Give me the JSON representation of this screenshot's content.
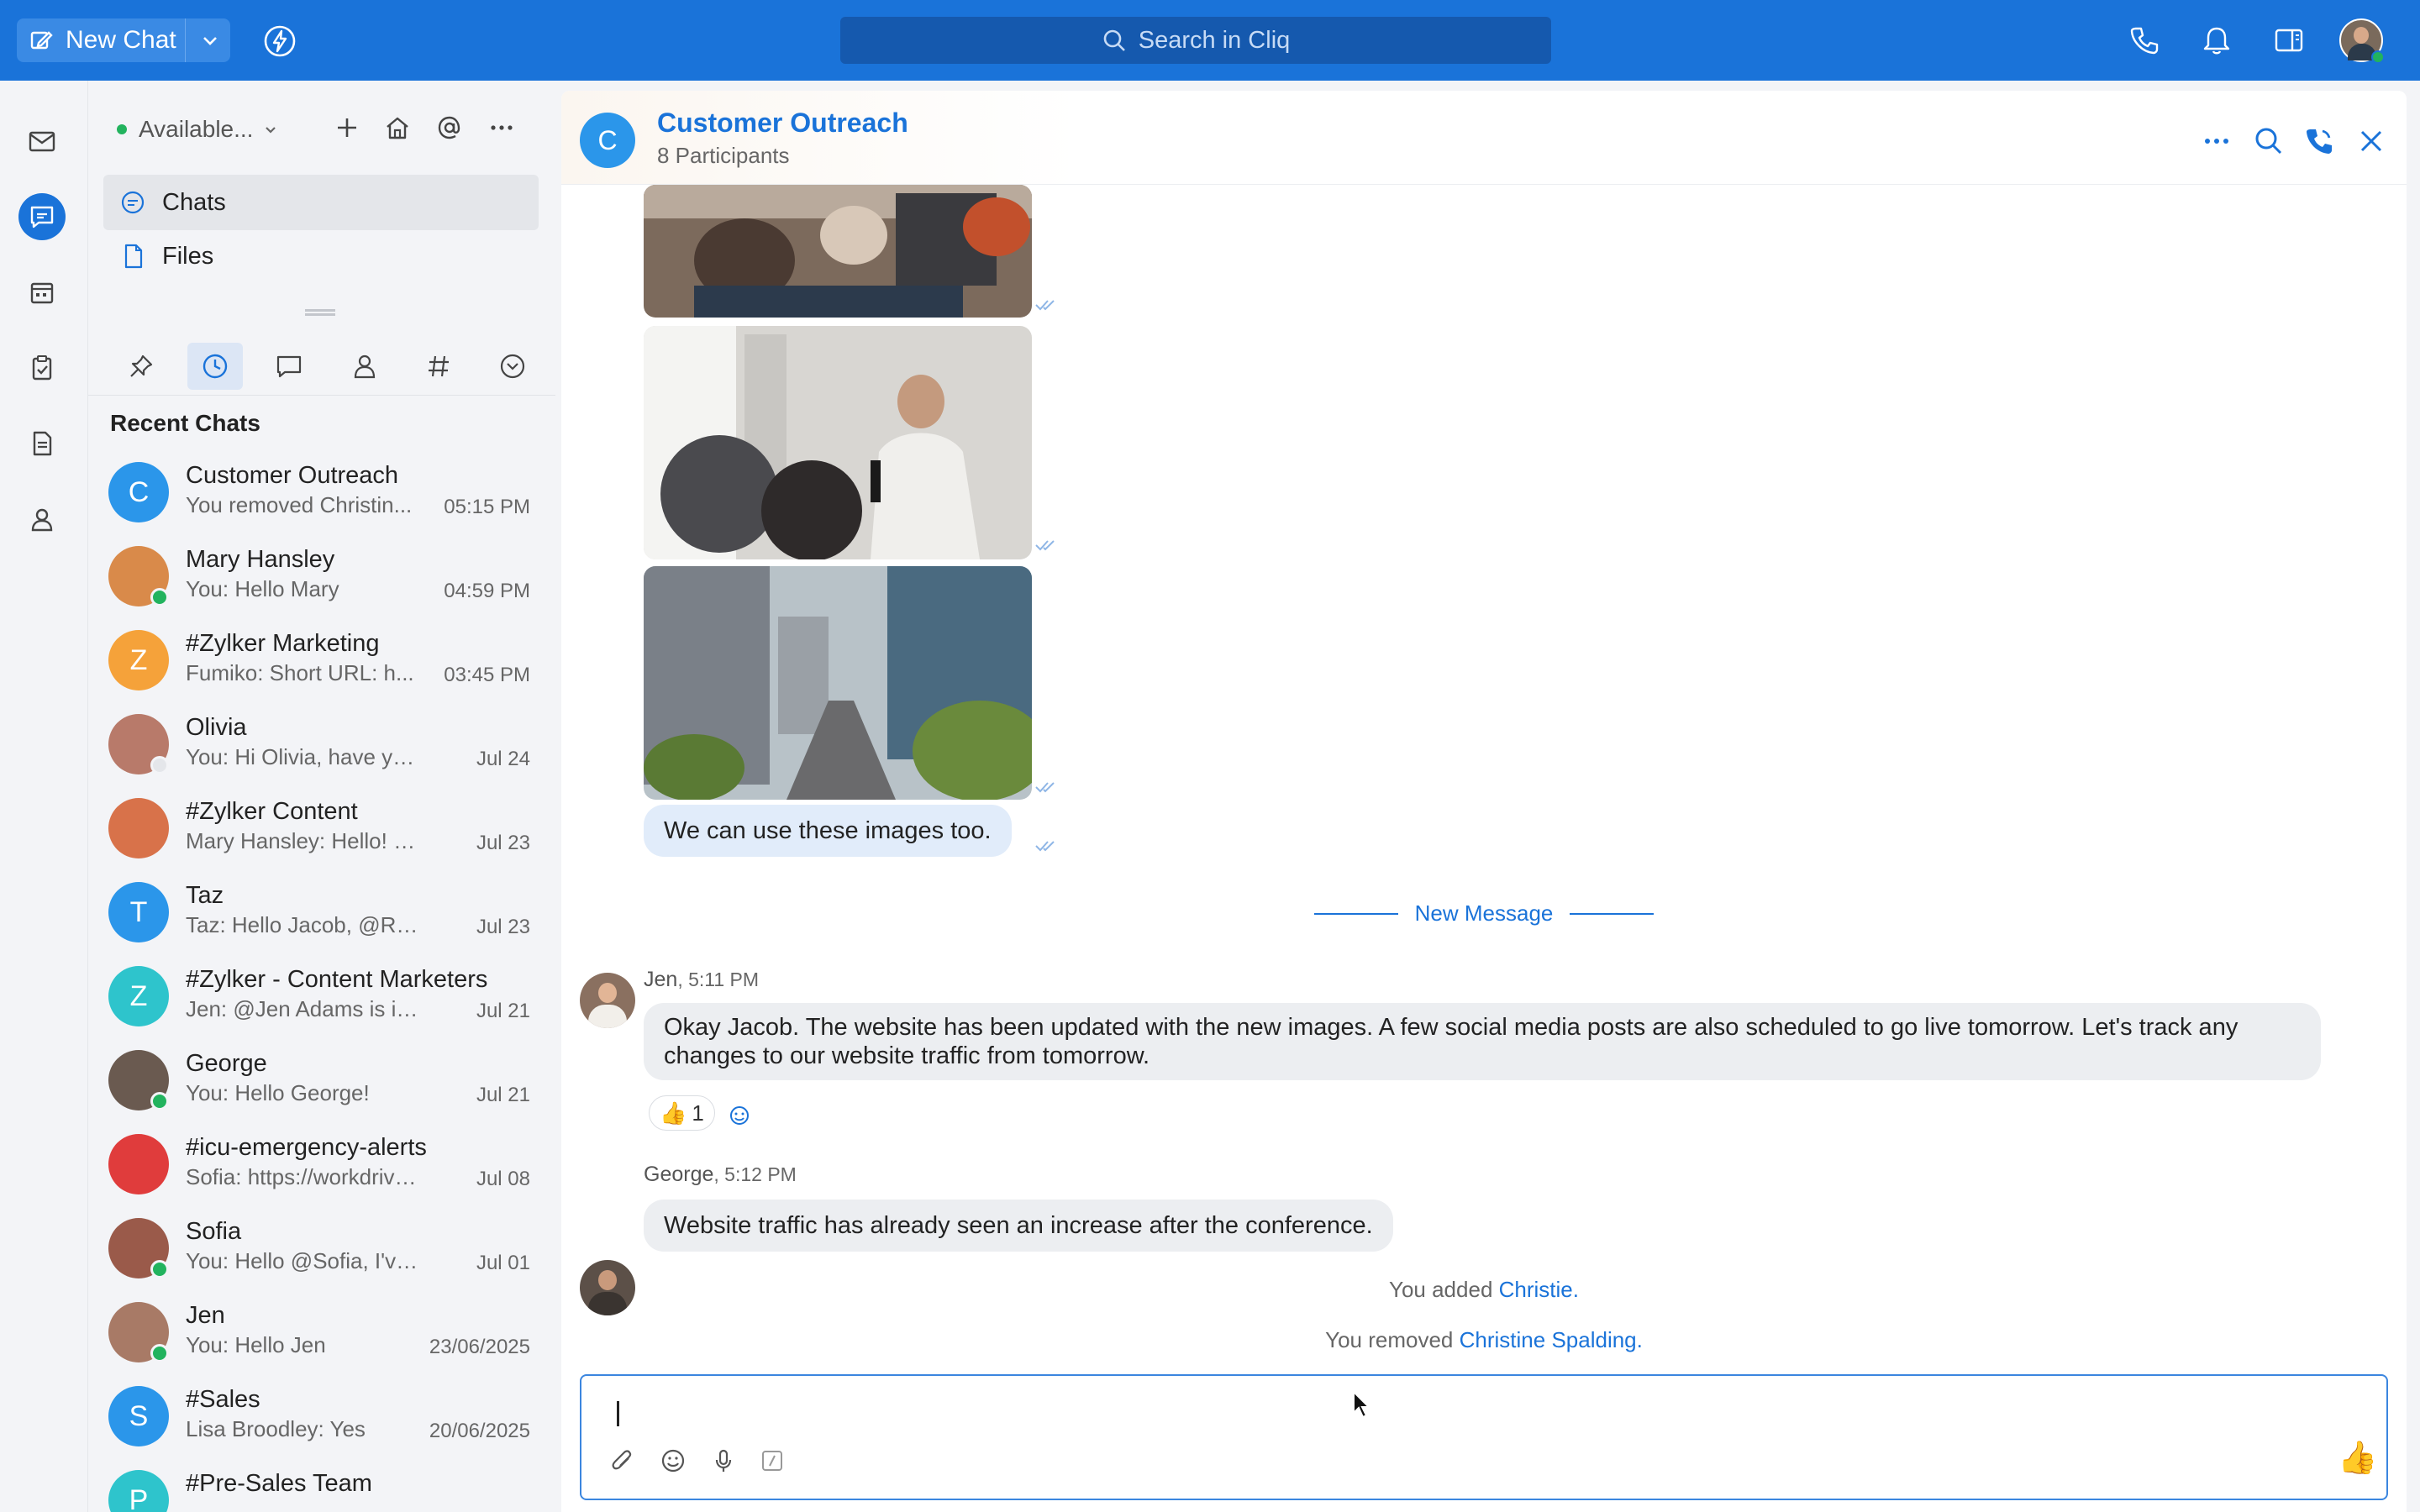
{
  "topbar": {
    "new_chat_label": "New Chat",
    "search_placeholder": "Search in Cliq"
  },
  "sidebar": {
    "status": "Available...",
    "nav": [
      {
        "label": "Chats"
      },
      {
        "label": "Files"
      }
    ],
    "recent_title": "Recent Chats",
    "chats": [
      {
        "name": "Customer Outreach",
        "preview": "You removed Christin...",
        "time": "05:15 PM",
        "initial": "C",
        "color": "#2b96ea"
      },
      {
        "name": "Mary  Hansley",
        "preview": "You: Hello Mary",
        "time": "04:59 PM",
        "initial": "",
        "color": "#d98a4a"
      },
      {
        "name": "#Zylker Marketing",
        "preview": "Fumiko: Short URL: h...",
        "time": "03:45 PM",
        "initial": "Z",
        "color": "#f5a23a"
      },
      {
        "name": "Olivia",
        "preview": "You: Hi Olivia, have you h...",
        "time": "Jul 24",
        "initial": "",
        "color": "#b87a6a"
      },
      {
        "name": "#Zylker Content",
        "preview": "Mary Hansley: Hello! @M...",
        "time": "Jul 23",
        "initial": "",
        "color": "#d8724a"
      },
      {
        "name": "Taz",
        "preview": "Taz: Hello Jacob,  @Regi...",
        "time": "Jul 23",
        "initial": "T",
        "color": "#2b96ea"
      },
      {
        "name": "#Zylker - Content Marketers",
        "preview": "Jen: @Jen Adams  is inviti...",
        "time": "Jul 21",
        "initial": "Z",
        "color": "#2ec4cc"
      },
      {
        "name": "George",
        "preview": "You: Hello George!",
        "time": "Jul 21",
        "initial": "",
        "color": "#6a5a50"
      },
      {
        "name": "#icu-emergency-alerts",
        "preview": "Sofia: https://workdrive....",
        "time": "Jul 08",
        "initial": "",
        "color": "#e03c3c"
      },
      {
        "name": "Sofia",
        "preview": "You: Hello @Sofia, I've sh...",
        "time": "Jul 01",
        "initial": "",
        "color": "#9a5a4a"
      },
      {
        "name": "Jen",
        "preview": "You: Hello Jen",
        "time": "23/06/2025",
        "initial": "",
        "color": "#a87a66"
      },
      {
        "name": "#Sales",
        "preview": "Lisa Broodley: Yes",
        "time": "20/06/2025",
        "initial": "S",
        "color": "#2b96ea"
      },
      {
        "name": "#Pre-Sales Team",
        "preview": "",
        "time": "",
        "initial": "P",
        "color": "#2ec4cc"
      }
    ]
  },
  "chat": {
    "title": "Customer Outreach",
    "initial": "C",
    "participants": "8 Participants",
    "my_message": "We can use these images too.",
    "new_message_label": "New Message",
    "messages": [
      {
        "sender": "Jen",
        "time": ", 5:11 PM",
        "text": "Okay Jacob. The website has been updated with the new images. A few social media posts are also scheduled to go live tomorrow. Let's track any changes to our website traffic from tomorrow."
      },
      {
        "sender": "George",
        "time": ", 5:12 PM",
        "text": "Website traffic has already seen an increase after the conference."
      }
    ],
    "reaction_count": "1",
    "system_1_prefix": "You added ",
    "system_1_link": "Christie.",
    "system_2_prefix": "You removed ",
    "system_2_link": "Christine Spalding."
  }
}
